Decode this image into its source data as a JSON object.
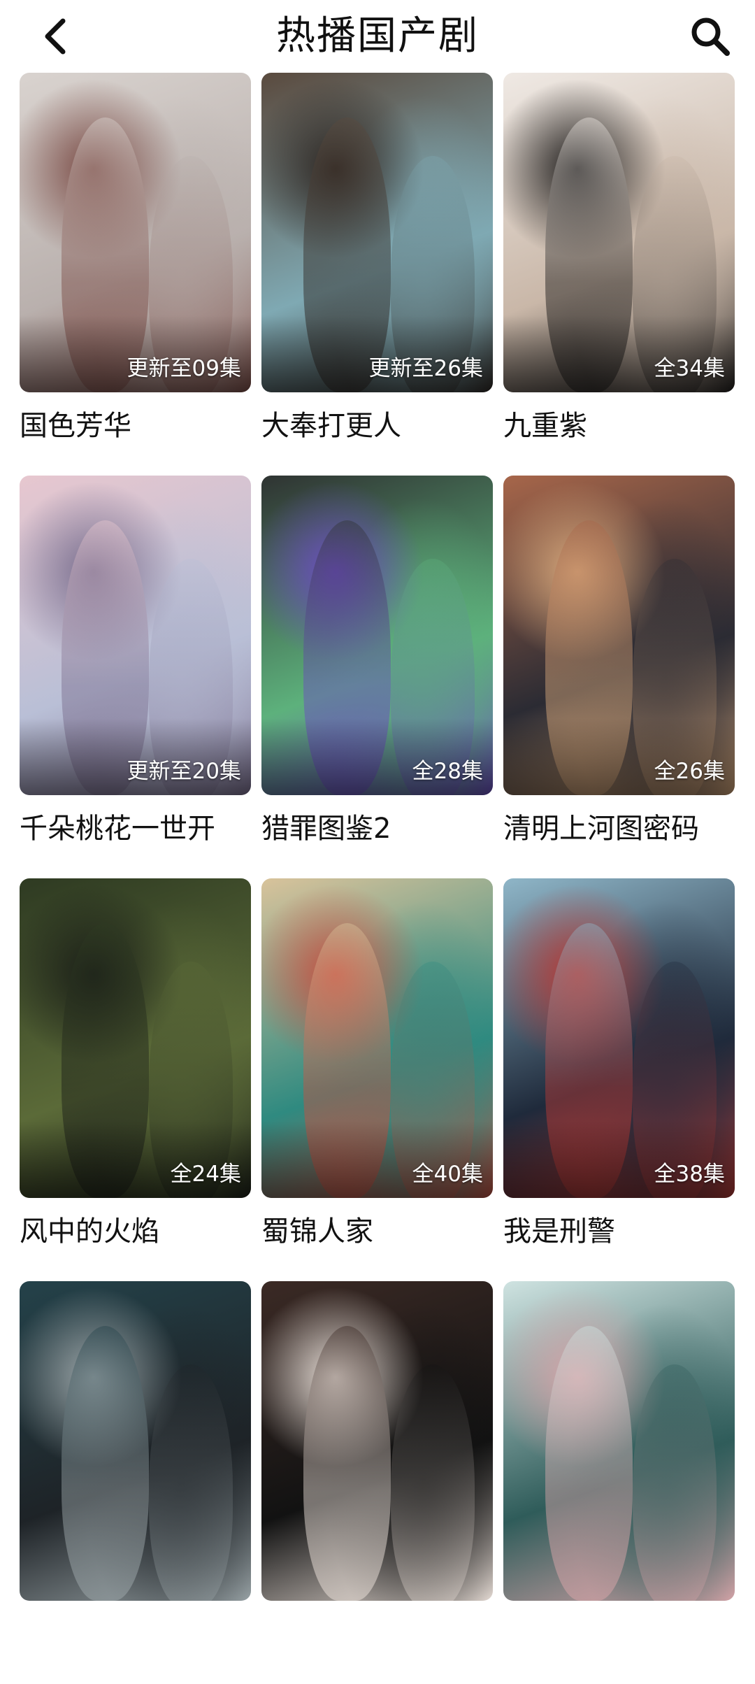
{
  "header": {
    "title": "热播国产剧",
    "back_icon": "chevron-left-icon",
    "search_icon": "search-icon"
  },
  "shows": [
    {
      "title": "国色芳华",
      "badge": "更新至09集",
      "colors": [
        "#d9d3cf",
        "#b9b0ad",
        "#7a4b45"
      ]
    },
    {
      "title": "大奉打更人",
      "badge": "更新至26集",
      "colors": [
        "#5a4a3e",
        "#7fa9b3",
        "#2d2622"
      ]
    },
    {
      "title": "九重紫",
      "badge": "全34集",
      "colors": [
        "#efe9e4",
        "#c9b7a8",
        "#1e1c1b"
      ]
    },
    {
      "title": "千朵桃花一世开",
      "badge": "更新至20集",
      "colors": [
        "#e7c7cf",
        "#b9bfd6",
        "#7a6e8e"
      ]
    },
    {
      "title": "猎罪图鉴2",
      "badge": "全28集",
      "colors": [
        "#2f3332",
        "#5db17c",
        "#6b4cc0"
      ]
    },
    {
      "title": "清明上河图密码",
      "badge": "全26集",
      "colors": [
        "#a7664a",
        "#2b2b33",
        "#d6a77b"
      ]
    },
    {
      "title": "风中的火焰",
      "badge": "全24集",
      "colors": [
        "#2e3a22",
        "#5b6a38",
        "#1b1f18"
      ]
    },
    {
      "title": "蜀锦人家",
      "badge": "全40集",
      "colors": [
        "#d9c39b",
        "#2f8a80",
        "#c55041"
      ]
    },
    {
      "title": "我是刑警",
      "badge": "全38集",
      "colors": [
        "#8fb6c8",
        "#1f2a3b",
        "#b73a36"
      ]
    },
    {
      "title": "",
      "badge": "",
      "colors": [
        "#24424a",
        "#1e2327",
        "#9aa4a7"
      ]
    },
    {
      "title": "",
      "badge": "",
      "colors": [
        "#3b2a25",
        "#121212",
        "#e7ddd6"
      ]
    },
    {
      "title": "",
      "badge": "",
      "colors": [
        "#cfe3e1",
        "#2f5c5a",
        "#d6a4a8"
      ]
    }
  ]
}
